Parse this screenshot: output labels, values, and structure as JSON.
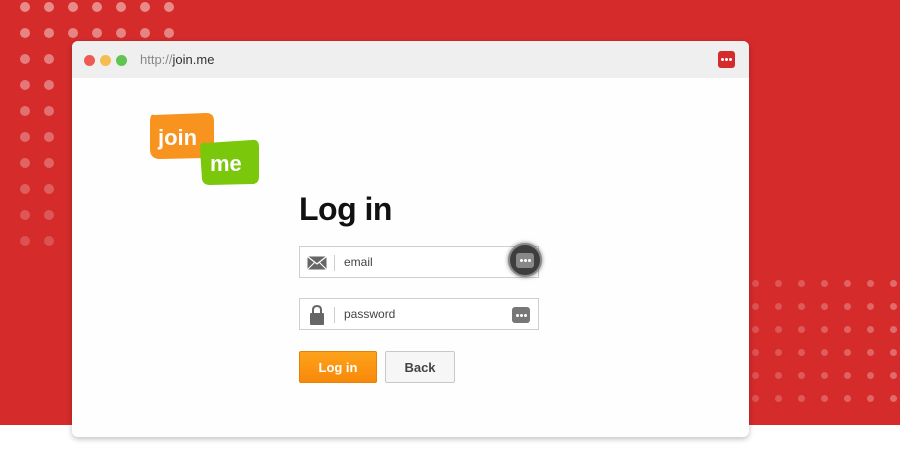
{
  "browser": {
    "url_protocol": "http://",
    "url_domain": "join.me",
    "traffic_light_colors": [
      "#ee5a52",
      "#f5bd4f",
      "#5fc453"
    ],
    "extension_icon": "lastpass-icon"
  },
  "logo": {
    "word1": "join",
    "word2": "me",
    "color1": "#f7931e",
    "color2": "#7ac70c"
  },
  "login": {
    "heading": "Log in",
    "email_placeholder": "email",
    "password_placeholder": "password",
    "login_button": "Log in",
    "back_button": "Back"
  },
  "colors": {
    "background_red": "#d52b2b",
    "button_orange": "#f8890a"
  },
  "icons": {
    "email": "envelope-icon",
    "password": "lock-icon",
    "password_manager": "lastpass-icon"
  }
}
